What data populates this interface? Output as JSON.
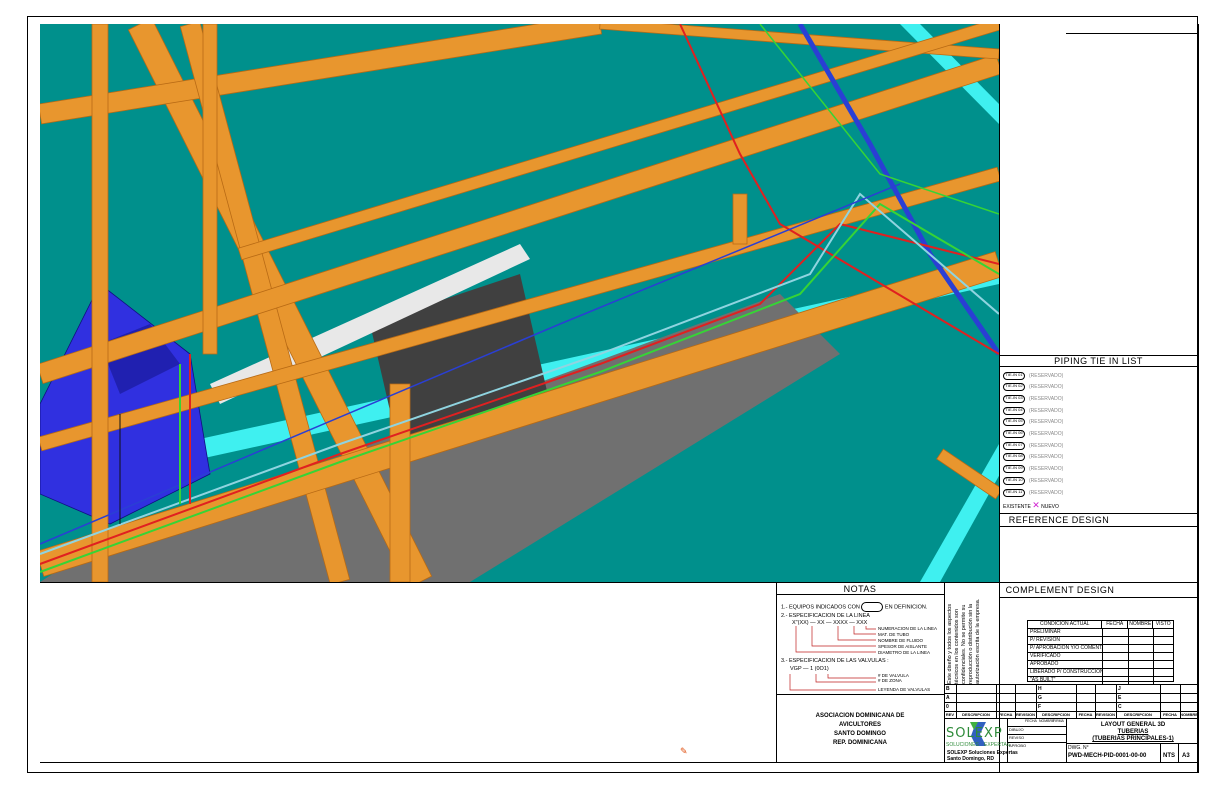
{
  "viewport": {
    "description_label": "",
    "colors": {
      "background": "#00908c",
      "beam": "#e8962e",
      "beam_shadow": "#b86a14",
      "pipe_blue": "#2a3fd4",
      "pipe_red": "#e02020",
      "pipe_green": "#36d436",
      "pipe_cyan": "#8fd4e0",
      "equipment": "#3030e0",
      "floor_strip": "#3ff0f0",
      "gray": "#707070",
      "dark": "#404040"
    }
  },
  "tie_in_list": {
    "title": "PIPING TIE IN LIST",
    "items": [
      {
        "tag": "TIE-IN 01",
        "value": "(RESERVADO)"
      },
      {
        "tag": "TIE-IN 02",
        "value": "(RESERVADO)"
      },
      {
        "tag": "TIE-IN 03",
        "value": "(RESERVADO)"
      },
      {
        "tag": "TIE-IN 04",
        "value": "(RESERVADO)"
      },
      {
        "tag": "TIE-IN 05",
        "value": "(RESERVADO)"
      },
      {
        "tag": "TIE-IN 06",
        "value": "(RESERVADO)"
      },
      {
        "tag": "TIE-IN 07",
        "value": "(RESERVADO)"
      },
      {
        "tag": "TIE-IN 08",
        "value": "(RESERVADO)"
      },
      {
        "tag": "TIE-IN 09",
        "value": "(RESERVADO)"
      },
      {
        "tag": "TIE-IN 10",
        "value": "(RESERVADO)"
      },
      {
        "tag": "TIE-IN 11",
        "value": "(RESERVADO)"
      }
    ],
    "legend_existing": "EXISTENTE",
    "legend_new": "NUEVO"
  },
  "reference_design": {
    "title": "REFERENCE DESIGN"
  },
  "complement_design": {
    "title": "COMPLEMENT DESIGN"
  },
  "status_table": {
    "headers": [
      "CONDICION ACTUAL",
      "FECHA",
      "NOMBRE",
      "VISTO"
    ],
    "rows": [
      "PRELIMINAR",
      "P/ REVISION",
      "P/ APROBACION Y/O COMENTARIOS",
      "VERIFICADO",
      "APROBADO",
      "LIBERADO P/ CONSTRUCCION",
      "\"AS BUILT\""
    ]
  },
  "notes": {
    "title": "NOTAS",
    "n1": "1.- EQUIPOS INDICADOS CON",
    "n1_tail": "EN DEFINICION.",
    "n2": "2.- ESPECIFICACION DE LA LINEA",
    "n2_code": "X\"(XX) — XX — XXXX — XXX",
    "n2_labels": [
      "NUMERACION DE LA LINEA",
      "MAT. DE TUBO",
      "NOMBRE DE FLUIDO",
      "SPESOR DE AISLANTE",
      "DIAMETRO DE LA LINEA"
    ],
    "n3": "3.- ESPECIFICACION DE LAS VALVULAS :",
    "n3_code": "VGP — 1 (0O1)",
    "n3_labels": [
      "# DE VALVULA",
      "# DE ZONA",
      "LEYENDA DE VALVULAS"
    ]
  },
  "vertical_note": "Este diseño y todos los aspectos técnicos en los contenidos son confidenciales. No se permite su reproducción o distribución sin la autorización escrita de la empresa.",
  "client": {
    "line1": "ASOCIACION DOMINICANA DE",
    "line2": "AVICULTORES",
    "line3": "SANTO DOMINGO",
    "line4": "REP. DOMINICANA"
  },
  "revisions": {
    "left_letters": [
      "B",
      "A",
      "0"
    ],
    "mid_letters": [
      "H",
      "G",
      "F"
    ],
    "right_letters": [
      "J",
      "E",
      "C"
    ],
    "headers": [
      "REV",
      "DESCRIPCION",
      "FECHA",
      "REVISION",
      "DESCRIPCION",
      "FECHA",
      "REVISION",
      "DESCRIPCION",
      "FECHA",
      "NOMBRE"
    ]
  },
  "drawing": {
    "title_line1": "LAYOUT GENERAL 3D",
    "title_line2": "TUBERIAS",
    "title_line3": "(TUBERIAS PRINCIPALES-1)",
    "drawn_labels": [
      "FECHA",
      "NOMBRE",
      "FIRMA"
    ],
    "roles": [
      "DIBUJO",
      "REVISO",
      "APROBO"
    ],
    "dwg_no_label": "DWG. N°",
    "dwg_no": "PWD-MECH-PID-0001-00-00",
    "scale": "NTS",
    "size": "A3"
  },
  "company": {
    "logo": "SOLEXP",
    "tagline_left": "SOLUCIONES",
    "tagline_right": "EXPERTAS",
    "address1": "SOLEXP Soluciones Expertas",
    "address2": "Santo Domingo, RD"
  }
}
